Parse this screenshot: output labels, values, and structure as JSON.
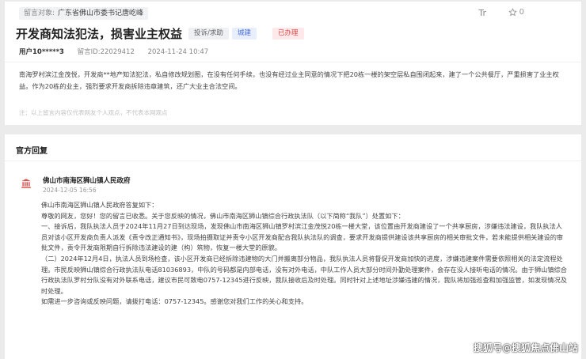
{
  "header": {
    "target_key": "留言对象:",
    "target_value": "广东省佛山市委书记唐屹峰",
    "font_toggle": "Tr",
    "star_count": "0"
  },
  "post": {
    "title": "开发商知法犯法，损害业主权益",
    "badges": {
      "type": "投诉/求助",
      "field": "城建",
      "status": "已办理"
    },
    "user": "用户10*****3",
    "message_id": "留言ID:22029412",
    "time": "2024-11-24 10:47",
    "content": "南海罗村滨江金茂悦，开发商**地产知法犯法，私自修改规划图，在没有任何手续，也没有经过业主同意的情况下把20栋一楼的架空层私自围闭起来，建了一个公共餐厅，严重损害了业主权益。作为20栋的业主，强烈要求开发商拆除违章建筑，还广大业主合法空间。",
    "note": "注：以上留言内容仅代表网友个人观点，不代表本网观点"
  },
  "reply": {
    "heading": "官方回复",
    "org": "佛山市南海区狮山镇人民政府",
    "date": "2024-12-05 16:56",
    "paragraphs": [
      "佛山市南海区狮山镇人民政府答复如下：",
      "尊敬的网友，您好！您的留言已收悉。关于您反映的情况，佛山市南海区狮山镇综合行政执法队（以下简称“我队”）处置如下：",
      "一、接诉后，我队执法人员于2024年11月27日到达现场，发现佛山市南海区狮山镇罗村滨江金茂悦20栋一楼大堂，该位置由开发商建设了一个共享厨房，涉嫌违法建设，我队执法人员对该小区开发商负责人派发《责令改正通知书》，现场拍摄取证并责令小区开发商配合我队执法队的调查，要求开发商提供建设该共享厨房的相关审批文件，若未能提供相关建设的审批文件，责令开发商限期自行拆除违法建设的建（构）筑物，恢复一楼大堂的原貌。",
      "（二）2024年12月4日，执法人员到场检查，该小区开发商已经拆除违建物的大门并搬离部分物品，我队执法人员将督促开发商加快的进度，涉嫌违建案件需要依照相关的法定流程处理。市民反映狮山镇综合行政执法队电话81036893，中队的号码都是内部电话，没有对外电话，中队工作人员大部分时间外勤处理案件，会存在没人接听电话的情况。由于狮山镇综合行政执法队罗村分队没有对外联系电话，建议市民可致电0757-12345进行反映，我队接收后及时处理。同时针对上述地址涉嫌违建的情况，我队将加强巡查和加强监管，如发现情况及时处理。",
      "如需进一步咨询或反映问题，请拨打电话：0757-12345。感谢您对我们工作的关心和支持。"
    ]
  },
  "watermark": "搜狐号@搜狐焦点佛山站",
  "colors": {
    "background": "#ebebec",
    "status_red": "#e64646",
    "field_blue": "#4a6fd8",
    "org_icon_red": "#d9534f"
  }
}
